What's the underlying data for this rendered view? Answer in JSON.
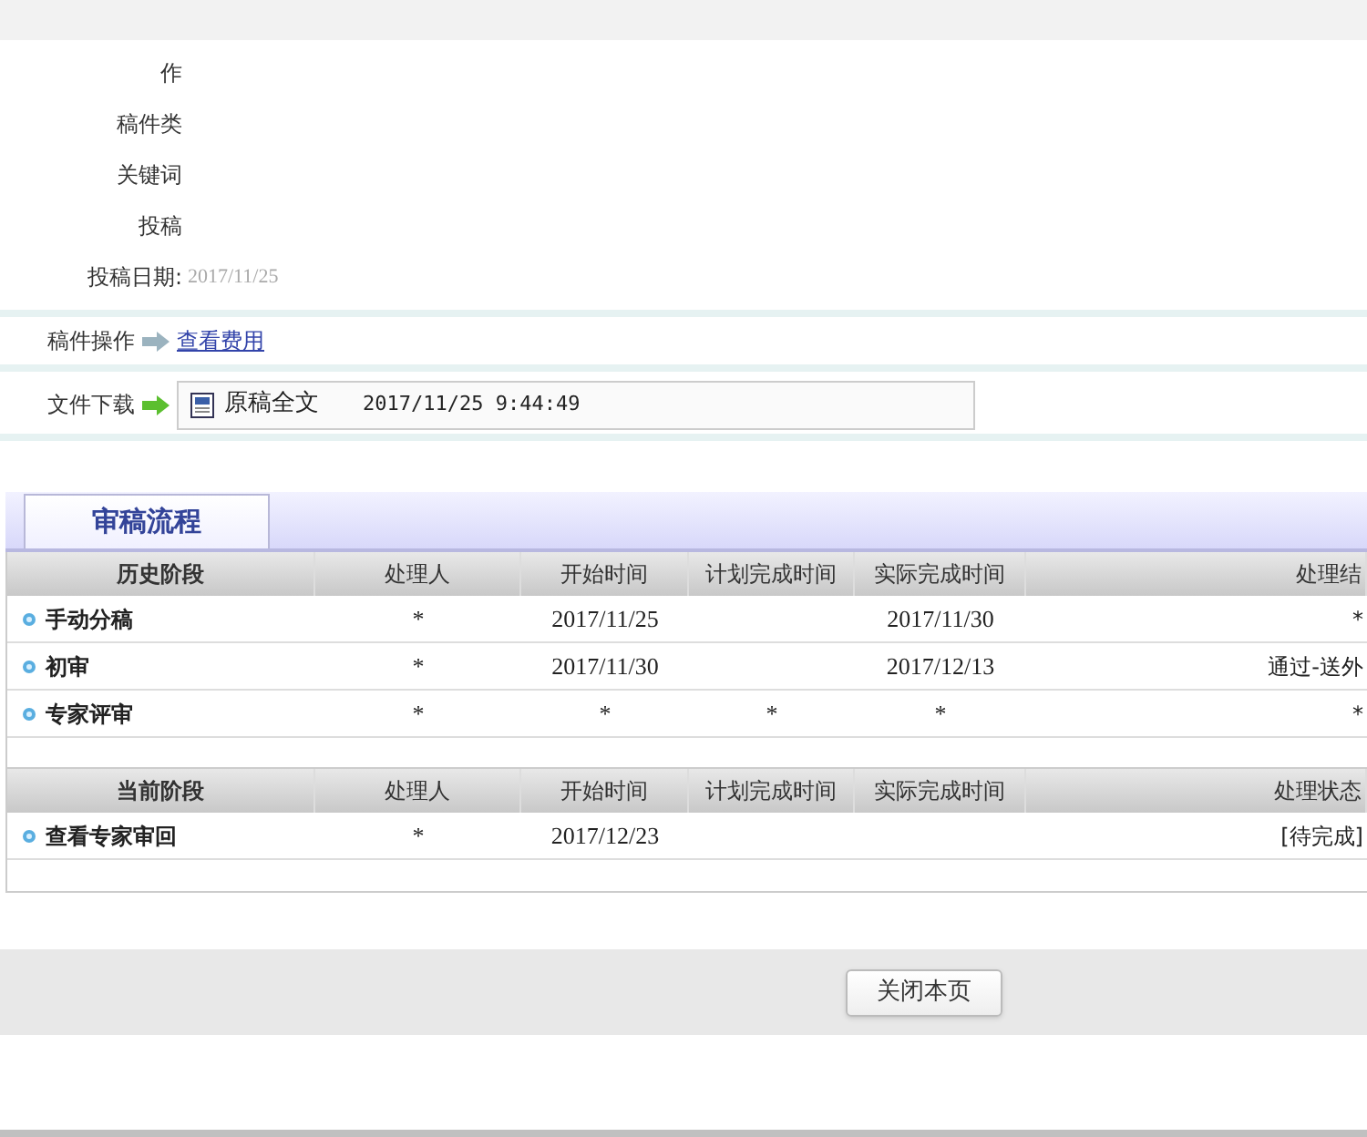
{
  "info_fields": [
    {
      "label": "作"
    },
    {
      "label": "稿件类"
    },
    {
      "label": "关键词"
    },
    {
      "label": "投稿"
    },
    {
      "label": "投稿日期:",
      "value": "2017/11/25"
    }
  ],
  "operation": {
    "label": "稿件操作",
    "link": "查看费用"
  },
  "download": {
    "label": "文件下载",
    "file": "原稿全文",
    "time": "2017/11/25 9:44:49"
  },
  "tab": {
    "label": "审稿流程",
    "selected": true
  },
  "history": {
    "columns": [
      "历史阶段",
      "处理人",
      "开始时间",
      "计划完成时间",
      "实际完成时间",
      "处理结"
    ],
    "rows": [
      [
        "手动分稿",
        "*",
        "2017/11/25",
        "",
        "2017/11/30",
        "*"
      ],
      [
        "初审",
        "*",
        "2017/11/30",
        "",
        "2017/12/13",
        "通过-送外"
      ],
      [
        "专家评审",
        "*",
        "*",
        "*",
        "*",
        "*"
      ]
    ]
  },
  "current": {
    "columns": [
      "当前阶段",
      "处理人",
      "开始时间",
      "计划完成时间",
      "实际完成时间",
      "处理状态"
    ],
    "rows": [
      [
        "查看专家审回",
        "*",
        "2017/12/23",
        "",
        "",
        "[待完成]"
      ]
    ]
  },
  "close_button": "关闭本页"
}
